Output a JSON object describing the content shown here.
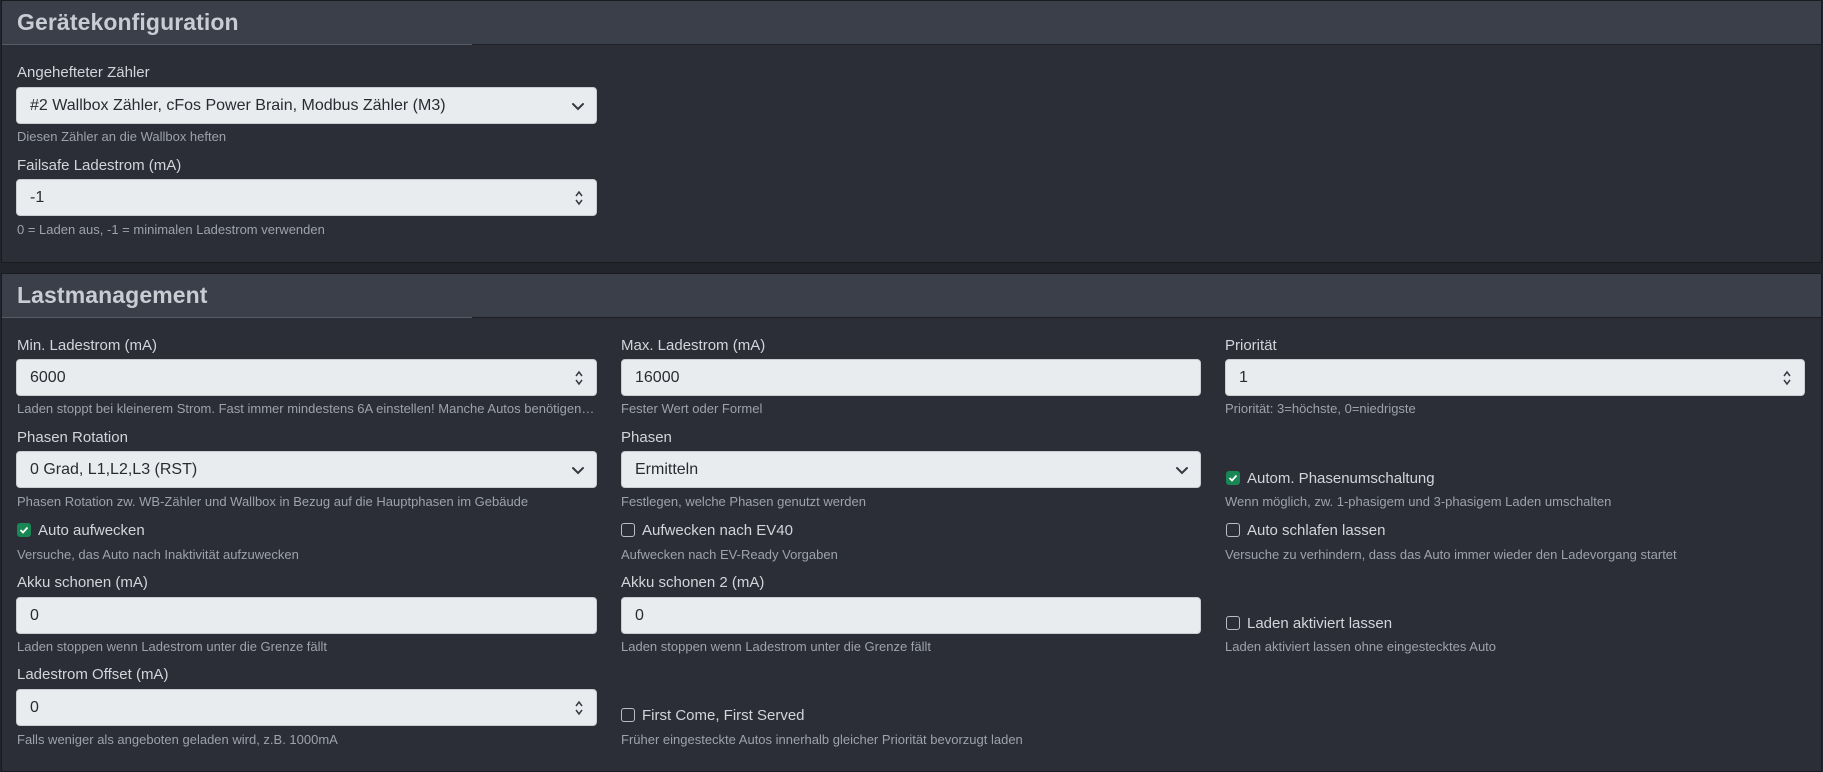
{
  "device_config": {
    "title": "Gerätekonfiguration",
    "meter": {
      "label": "Angehefteter Zähler",
      "value": "#2 Wallbox Zähler, cFos Power Brain, Modbus Zähler (M3)",
      "help": "Diesen Zähler an die Wallbox heften"
    },
    "failsafe": {
      "label": "Failsafe Ladestrom (mA)",
      "value": "-1",
      "help": "0 = Laden aus, -1 = minimalen Ladestrom verwenden"
    }
  },
  "load_mgmt": {
    "title": "Lastmanagement",
    "min_current": {
      "label": "Min. Ladestrom (mA)",
      "value": "6000",
      "help": "Laden stoppt bei kleinerem Strom. Fast immer mindestens 6A einstellen! Manche Autos benötigen mehr."
    },
    "max_current": {
      "label": "Max. Ladestrom (mA)",
      "value": "16000",
      "help": "Fester Wert oder Formel"
    },
    "priority": {
      "label": "Priorität",
      "value": "1",
      "help": "Priorität: 3=höchste, 0=niedrigste"
    },
    "phase_rotation": {
      "label": "Phasen Rotation",
      "value": "0 Grad, L1,L2,L3 (RST)",
      "help": "Phasen Rotation zw. WB-Zähler und Wallbox in Bezug auf die Hauptphasen im Gebäude"
    },
    "phases": {
      "label": "Phasen",
      "value": "Ermitteln",
      "help": "Festlegen, welche Phasen genutzt werden"
    },
    "auto_phase_switch": {
      "label": "Autom. Phasenumschaltung",
      "checked": true,
      "help": "Wenn möglich, zw. 1-phasigem und 3-phasigem Laden umschalten"
    },
    "wake_car": {
      "label": "Auto aufwecken",
      "checked": true,
      "help": "Versuche, das Auto nach Inaktivität aufzuwecken"
    },
    "wake_ev40": {
      "label": "Aufwecken nach EV40",
      "checked": false,
      "help": "Aufwecken nach EV-Ready Vorgaben"
    },
    "let_sleep": {
      "label": "Auto schlafen lassen",
      "checked": false,
      "help": "Versuche zu verhindern, dass das Auto immer wieder den Ladevorgang startet"
    },
    "battery_save": {
      "label": "Akku schonen (mA)",
      "value": "0",
      "help": "Laden stoppen wenn Ladestrom unter die Grenze fällt"
    },
    "battery_save2": {
      "label": "Akku schonen 2 (mA)",
      "value": "0",
      "help": "Laden stoppen wenn Ladestrom unter die Grenze fällt"
    },
    "keep_enabled": {
      "label": "Laden aktiviert lassen",
      "checked": false,
      "help": "Laden aktiviert lassen ohne eingestecktes Auto"
    },
    "offset": {
      "label": "Ladestrom Offset (mA)",
      "value": "0",
      "help": "Falls weniger als angeboten geladen wird, z.B. 1000mA"
    },
    "fcfs": {
      "label": "First Come, First Served",
      "checked": false,
      "help": "Früher eingesteckte Autos innerhalb gleicher Priorität bevorzugt laden"
    }
  },
  "colors": {
    "background": "#23252d",
    "panel": "#2b2d37",
    "header": "#3b3f49",
    "input": "#e9ecef",
    "check_on": "#198754"
  }
}
